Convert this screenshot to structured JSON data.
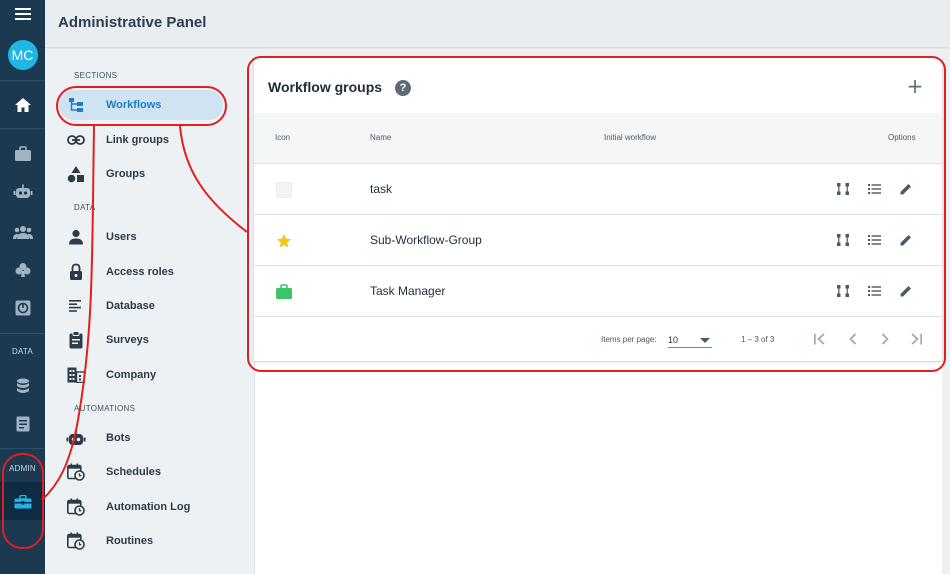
{
  "header": {
    "title": "Administrative Panel"
  },
  "rail": {
    "avatar_initials": "MC",
    "data_label": "DATA",
    "admin_label": "ADMIN",
    "active_color": "#1fb6e6"
  },
  "nav": {
    "sections_heading": "SECTIONS",
    "data_heading": "DATA",
    "automations_heading": "AUTOMATIONS",
    "items": [
      {
        "label": "Workflows",
        "icon": "workflow-icon"
      },
      {
        "label": "Link groups",
        "icon": "link-icon"
      },
      {
        "label": "Groups",
        "icon": "shapes-icon"
      },
      {
        "label": "Users",
        "icon": "person-icon"
      },
      {
        "label": "Access roles",
        "icon": "lock-icon"
      },
      {
        "label": "Database",
        "icon": "database-lines-icon"
      },
      {
        "label": "Surveys",
        "icon": "clipboard-icon"
      },
      {
        "label": "Company",
        "icon": "building-icon"
      },
      {
        "label": "Bots",
        "icon": "bot-icon"
      },
      {
        "label": "Schedules",
        "icon": "calendar-clock-icon"
      },
      {
        "label": "Automation Log",
        "icon": "calendar-clock-icon"
      },
      {
        "label": "Routines",
        "icon": "calendar-clock-icon"
      }
    ]
  },
  "card": {
    "title": "Workflow groups",
    "help_glyph": "?",
    "add_glyph": "+",
    "columns": {
      "icon": "Icon",
      "name": "Name",
      "initial_workflow": "Initial workflow",
      "options": "Options"
    },
    "rows": [
      {
        "icon": "blank-square-icon",
        "name": "task"
      },
      {
        "icon": "star-icon",
        "name": "Sub-Workflow-Group",
        "icon_color": "#f5c518"
      },
      {
        "icon": "briefcase-icon",
        "name": "Task Manager",
        "icon_color": "#3cc468"
      }
    ],
    "pager": {
      "items_per_page_label": "Items per page:",
      "items_per_page_value": "10",
      "range_label": "1 – 3 of 3"
    }
  },
  "colors": {
    "annotation": "#e02020",
    "accent": "#1e7fc0",
    "rail": "#1b3a52"
  }
}
